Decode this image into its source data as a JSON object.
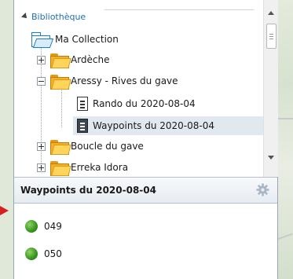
{
  "tree": {
    "library_label": "Bibliothèque",
    "collection_label": "Ma Collection",
    "items": [
      {
        "label": "Ardèche",
        "expanded": false
      },
      {
        "label": "Aressy - Rives du gave",
        "expanded": true
      },
      {
        "label": "Rando du 2020-08-04",
        "type": "document"
      },
      {
        "label": "Waypoints du 2020-08-04",
        "type": "document",
        "selected": true
      },
      {
        "label": "Boucle du gave",
        "expanded": false
      },
      {
        "label": "Erreka Idora",
        "expanded": false
      }
    ]
  },
  "waypoints_panel": {
    "title": "Waypoints du 2020-08-04",
    "items": [
      {
        "label": "049",
        "color": "#3c9a1f"
      },
      {
        "label": "050",
        "color": "#3c9a1f"
      }
    ]
  },
  "colors": {
    "library_text": "#1f6fb6",
    "folder_blue": "#1b7bc4",
    "folder_yellow": "#f3b128",
    "selection_bg": "#e2e8ef",
    "arrow_red": "#d62020"
  }
}
